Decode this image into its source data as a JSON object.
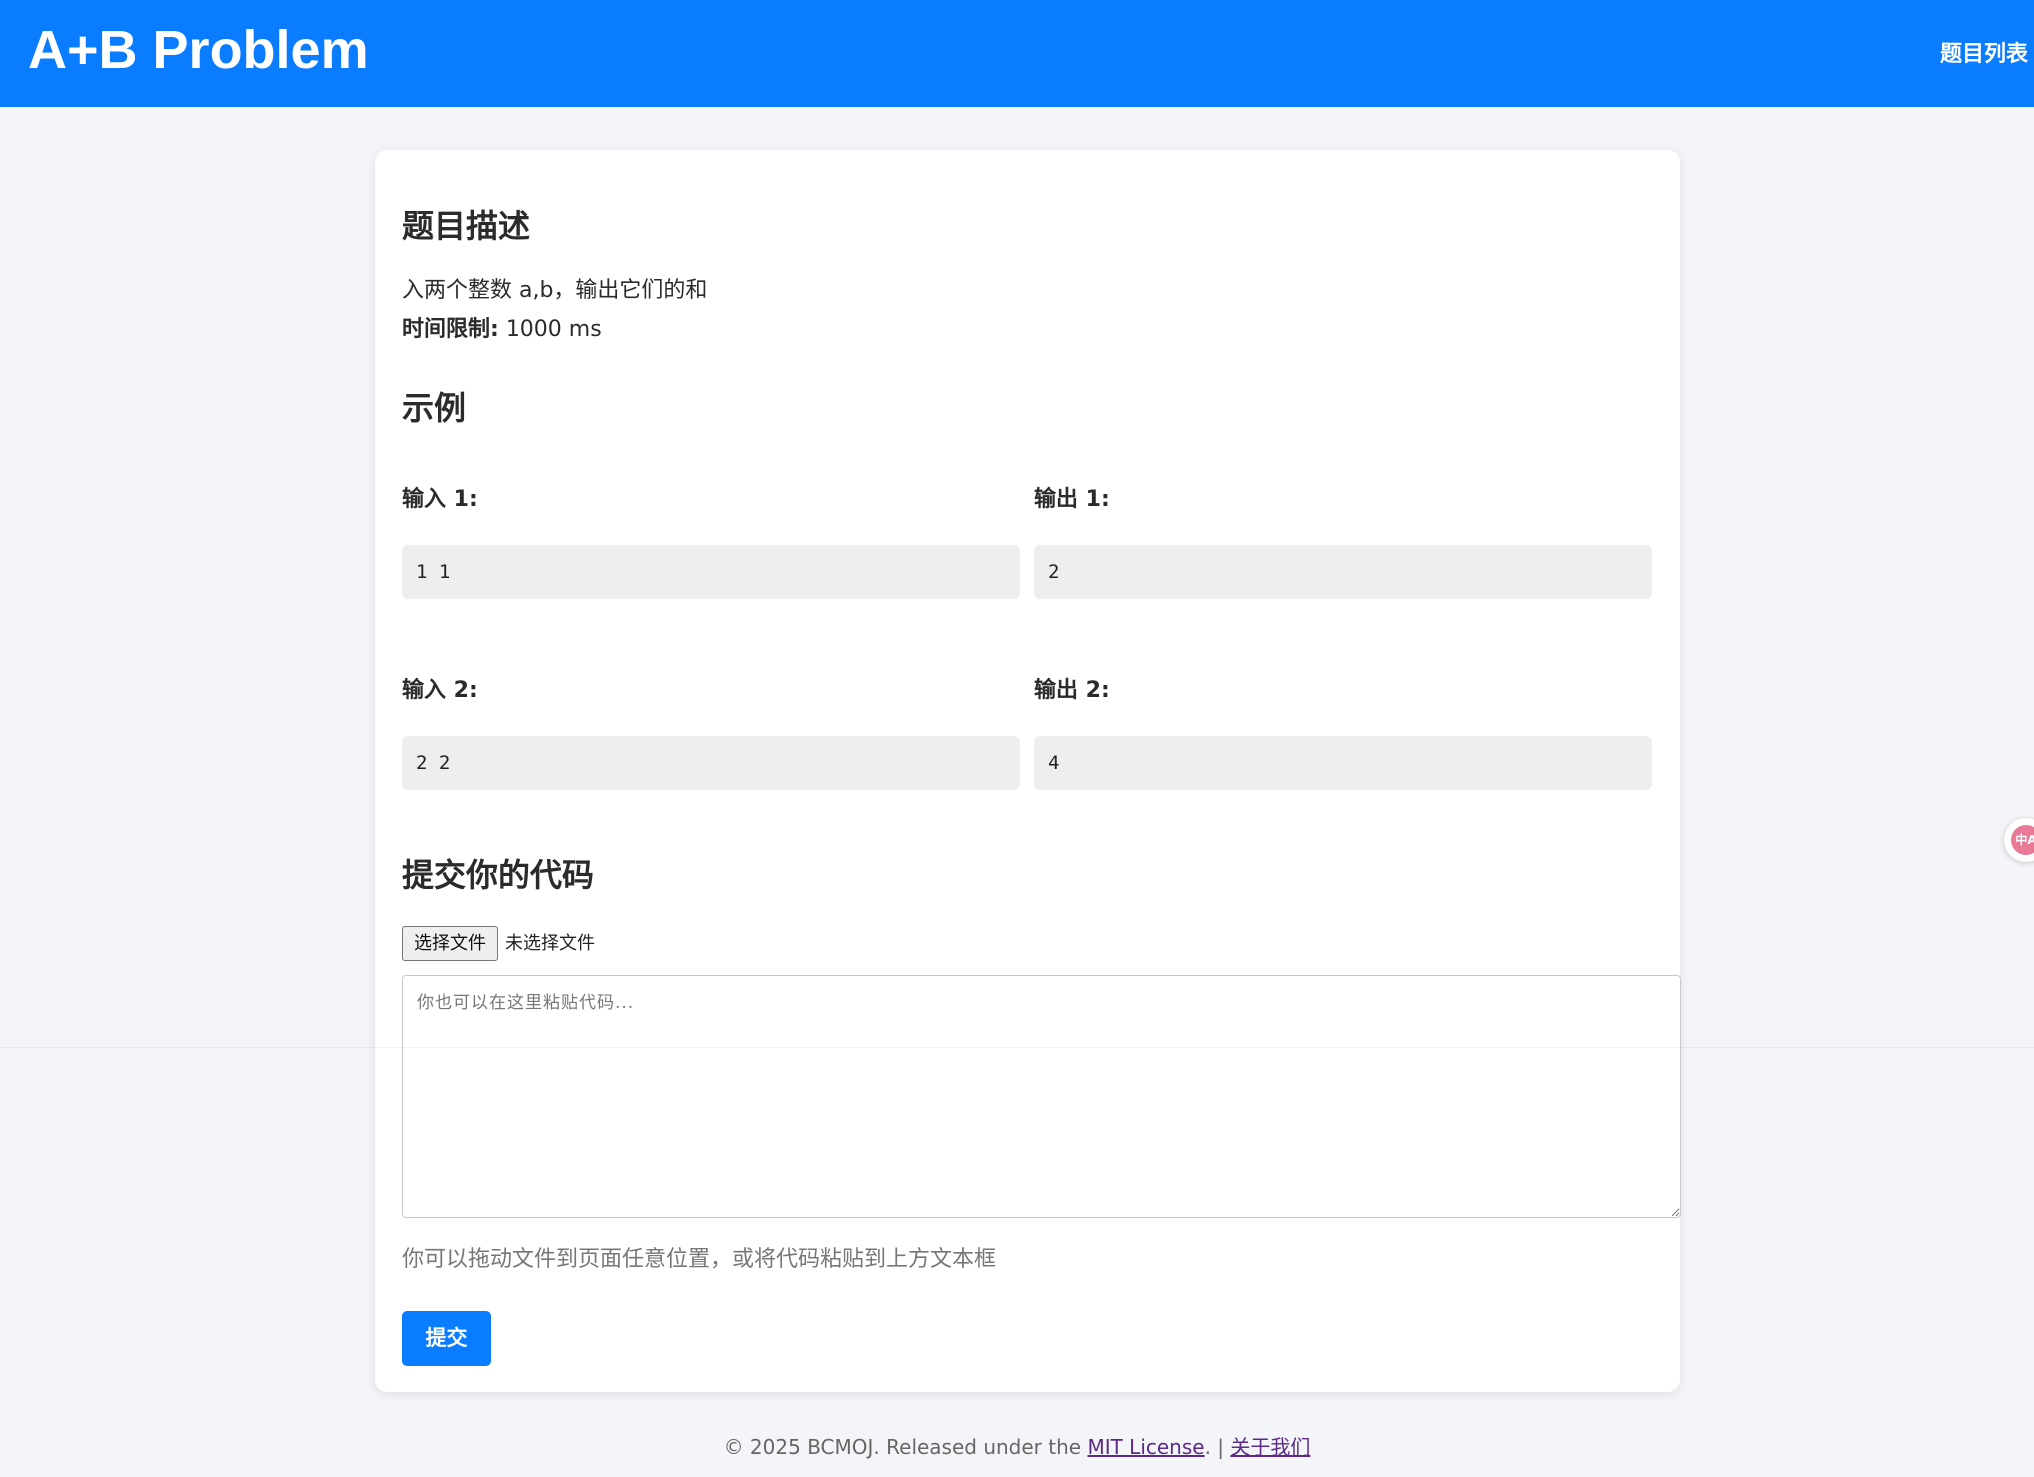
{
  "header": {
    "title": "A+B Problem",
    "nav_link": "题目列表",
    "bg_color": "#0a7cff"
  },
  "problem": {
    "description_heading": "题目描述",
    "description_text": "入两个整数 a,b，输出它们的和",
    "time_limit_label": "时间限制:",
    "time_limit_value": "1000 ms"
  },
  "examples": {
    "heading": "示例",
    "items": [
      {
        "input_label": "输入 1:",
        "input_value": "1 1",
        "output_label": "输出 1:",
        "output_value": "2"
      },
      {
        "input_label": "输入 2:",
        "input_value": "2 2",
        "output_label": "输出 2:",
        "output_value": "4"
      }
    ]
  },
  "submit": {
    "heading": "提交你的代码",
    "file_button_label": "选择文件",
    "file_status": "未选择文件",
    "code_placeholder": "你也可以在这里粘贴代码...",
    "hint": "你可以拖动文件到页面任意位置，或将代码粘贴到上方文本框",
    "submit_label": "提交"
  },
  "footer": {
    "copyright": "© 2025 BCMOJ. Released under the ",
    "license_link": "MIT License",
    "separator": ". | ",
    "about_link": "关于我们"
  },
  "translate_widget": {
    "icon": "translate-icon",
    "label": "中A"
  }
}
